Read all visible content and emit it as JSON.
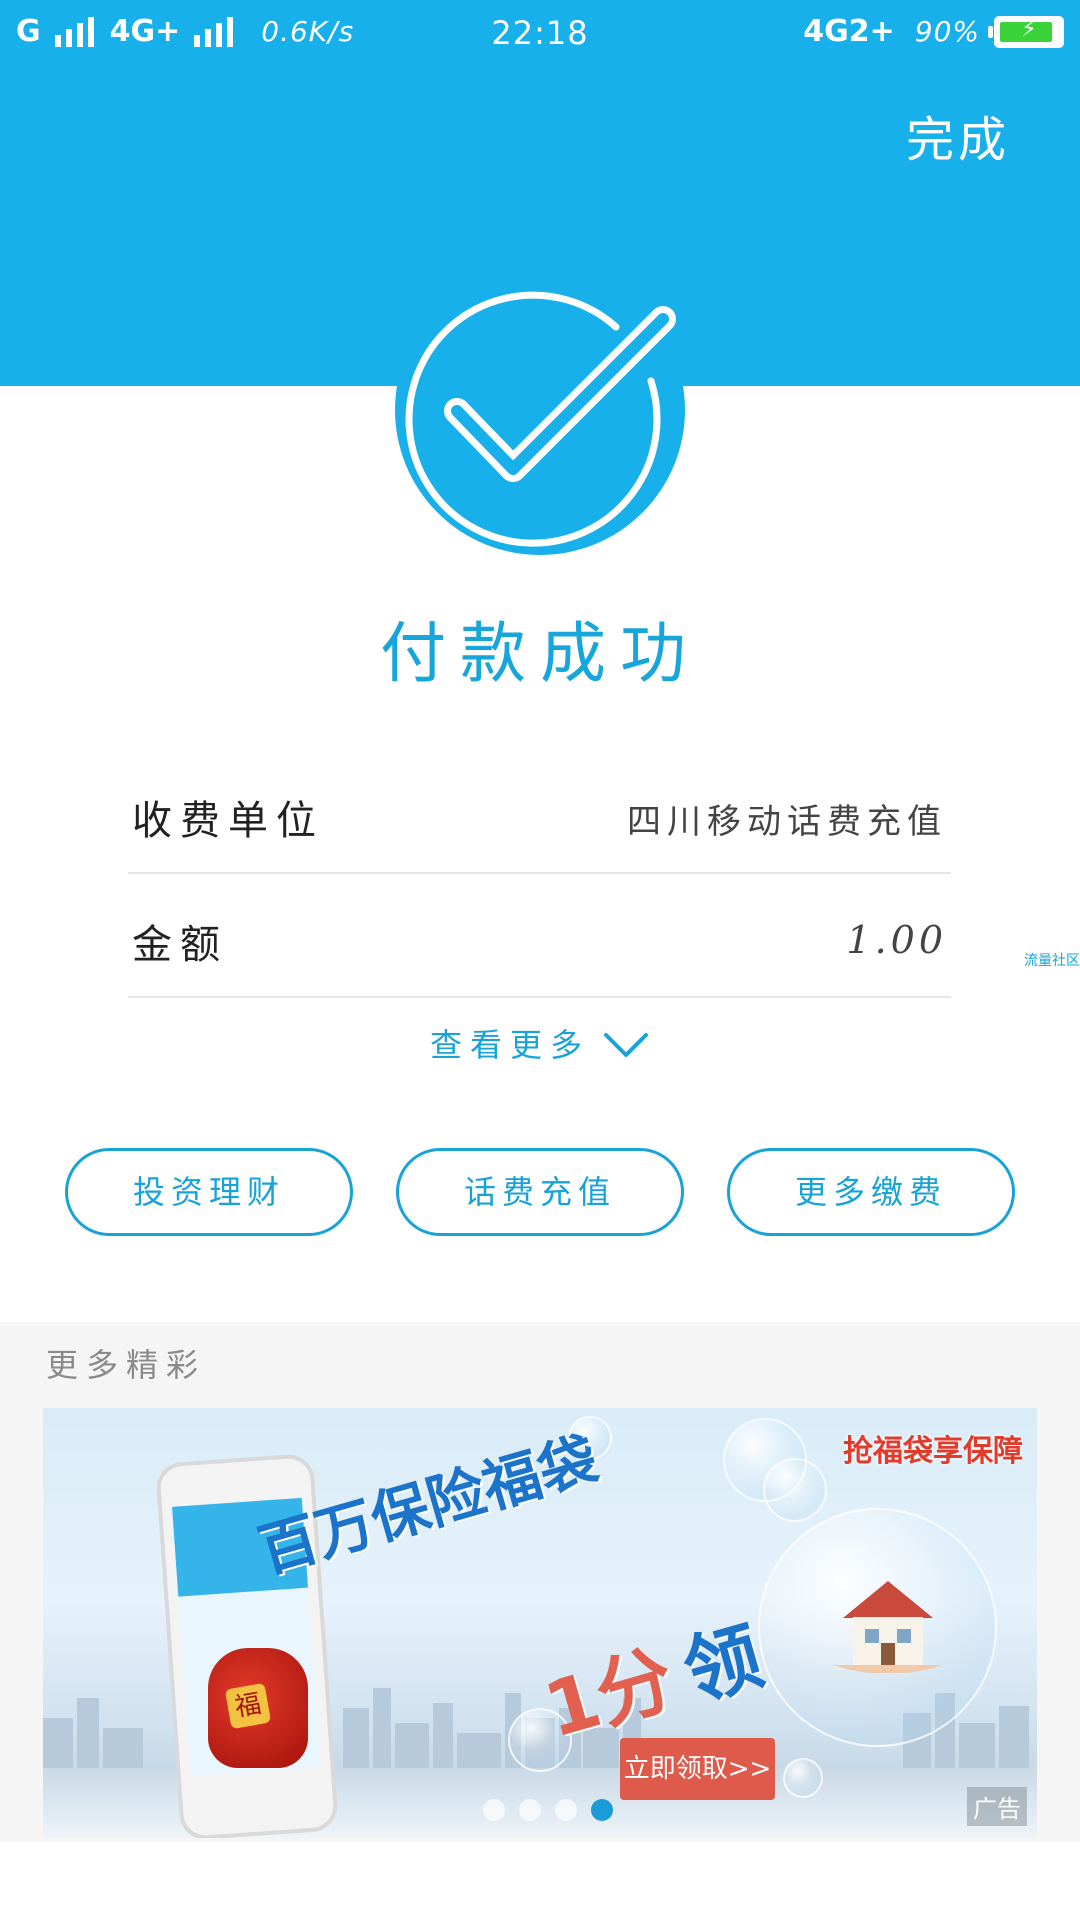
{
  "status_bar": {
    "left_sim1": "G",
    "left_sim2": "4G+",
    "speed": "0.6K/s",
    "time": "22:18",
    "network": "4G2+",
    "battery": "90%",
    "battery_level": 0.9
  },
  "header": {
    "done_label": "完成",
    "accent_color": "#17b0ea"
  },
  "result": {
    "title": "付款成功",
    "icon": "check-circle-icon"
  },
  "details": [
    {
      "key": "收费单位",
      "value": "四川移动话费充值"
    },
    {
      "key": "金额",
      "value": "1.00"
    }
  ],
  "more_link": {
    "label": "查看更多",
    "icon": "chevron-down-icon"
  },
  "actions": [
    {
      "label": "投资理财"
    },
    {
      "label": "话费充值"
    },
    {
      "label": "更多缴费"
    }
  ],
  "side_tag": "流量社区",
  "more_section": {
    "label": "更多精彩",
    "banner": {
      "headline": "百万保险福袋",
      "price_text": "1分",
      "price_suffix": "领",
      "promo_tag": "抢福袋享保障",
      "bag_text": "福",
      "cta": "立即领取>>",
      "ad_label": "广告",
      "total_slides": 4,
      "active_slide": 4
    }
  }
}
